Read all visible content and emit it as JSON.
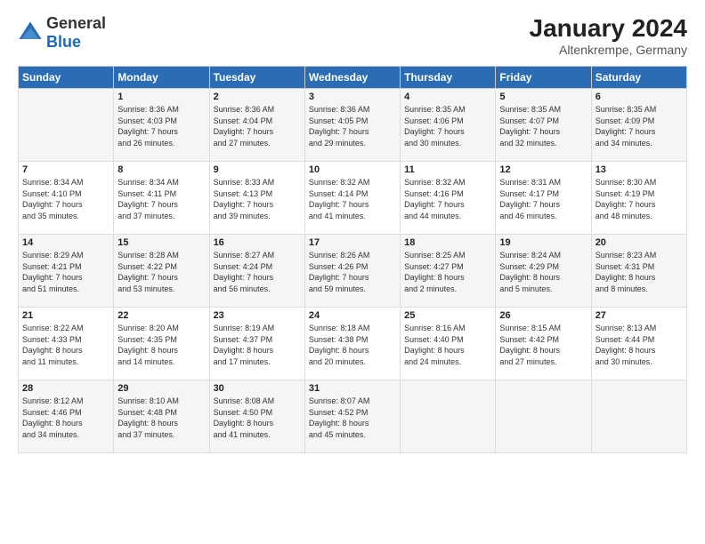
{
  "logo": {
    "general": "General",
    "blue": "Blue"
  },
  "header": {
    "month_year": "January 2024",
    "location": "Altenkrempe, Germany"
  },
  "days_of_week": [
    "Sunday",
    "Monday",
    "Tuesday",
    "Wednesday",
    "Thursday",
    "Friday",
    "Saturday"
  ],
  "weeks": [
    [
      {
        "day": "",
        "info": ""
      },
      {
        "day": "1",
        "info": "Sunrise: 8:36 AM\nSunset: 4:03 PM\nDaylight: 7 hours\nand 26 minutes."
      },
      {
        "day": "2",
        "info": "Sunrise: 8:36 AM\nSunset: 4:04 PM\nDaylight: 7 hours\nand 27 minutes."
      },
      {
        "day": "3",
        "info": "Sunrise: 8:36 AM\nSunset: 4:05 PM\nDaylight: 7 hours\nand 29 minutes."
      },
      {
        "day": "4",
        "info": "Sunrise: 8:35 AM\nSunset: 4:06 PM\nDaylight: 7 hours\nand 30 minutes."
      },
      {
        "day": "5",
        "info": "Sunrise: 8:35 AM\nSunset: 4:07 PM\nDaylight: 7 hours\nand 32 minutes."
      },
      {
        "day": "6",
        "info": "Sunrise: 8:35 AM\nSunset: 4:09 PM\nDaylight: 7 hours\nand 34 minutes."
      }
    ],
    [
      {
        "day": "7",
        "info": "Sunrise: 8:34 AM\nSunset: 4:10 PM\nDaylight: 7 hours\nand 35 minutes."
      },
      {
        "day": "8",
        "info": "Sunrise: 8:34 AM\nSunset: 4:11 PM\nDaylight: 7 hours\nand 37 minutes."
      },
      {
        "day": "9",
        "info": "Sunrise: 8:33 AM\nSunset: 4:13 PM\nDaylight: 7 hours\nand 39 minutes."
      },
      {
        "day": "10",
        "info": "Sunrise: 8:32 AM\nSunset: 4:14 PM\nDaylight: 7 hours\nand 41 minutes."
      },
      {
        "day": "11",
        "info": "Sunrise: 8:32 AM\nSunset: 4:16 PM\nDaylight: 7 hours\nand 44 minutes."
      },
      {
        "day": "12",
        "info": "Sunrise: 8:31 AM\nSunset: 4:17 PM\nDaylight: 7 hours\nand 46 minutes."
      },
      {
        "day": "13",
        "info": "Sunrise: 8:30 AM\nSunset: 4:19 PM\nDaylight: 7 hours\nand 48 minutes."
      }
    ],
    [
      {
        "day": "14",
        "info": "Sunrise: 8:29 AM\nSunset: 4:21 PM\nDaylight: 7 hours\nand 51 minutes."
      },
      {
        "day": "15",
        "info": "Sunrise: 8:28 AM\nSunset: 4:22 PM\nDaylight: 7 hours\nand 53 minutes."
      },
      {
        "day": "16",
        "info": "Sunrise: 8:27 AM\nSunset: 4:24 PM\nDaylight: 7 hours\nand 56 minutes."
      },
      {
        "day": "17",
        "info": "Sunrise: 8:26 AM\nSunset: 4:26 PM\nDaylight: 7 hours\nand 59 minutes."
      },
      {
        "day": "18",
        "info": "Sunrise: 8:25 AM\nSunset: 4:27 PM\nDaylight: 8 hours\nand 2 minutes."
      },
      {
        "day": "19",
        "info": "Sunrise: 8:24 AM\nSunset: 4:29 PM\nDaylight: 8 hours\nand 5 minutes."
      },
      {
        "day": "20",
        "info": "Sunrise: 8:23 AM\nSunset: 4:31 PM\nDaylight: 8 hours\nand 8 minutes."
      }
    ],
    [
      {
        "day": "21",
        "info": "Sunrise: 8:22 AM\nSunset: 4:33 PM\nDaylight: 8 hours\nand 11 minutes."
      },
      {
        "day": "22",
        "info": "Sunrise: 8:20 AM\nSunset: 4:35 PM\nDaylight: 8 hours\nand 14 minutes."
      },
      {
        "day": "23",
        "info": "Sunrise: 8:19 AM\nSunset: 4:37 PM\nDaylight: 8 hours\nand 17 minutes."
      },
      {
        "day": "24",
        "info": "Sunrise: 8:18 AM\nSunset: 4:38 PM\nDaylight: 8 hours\nand 20 minutes."
      },
      {
        "day": "25",
        "info": "Sunrise: 8:16 AM\nSunset: 4:40 PM\nDaylight: 8 hours\nand 24 minutes."
      },
      {
        "day": "26",
        "info": "Sunrise: 8:15 AM\nSunset: 4:42 PM\nDaylight: 8 hours\nand 27 minutes."
      },
      {
        "day": "27",
        "info": "Sunrise: 8:13 AM\nSunset: 4:44 PM\nDaylight: 8 hours\nand 30 minutes."
      }
    ],
    [
      {
        "day": "28",
        "info": "Sunrise: 8:12 AM\nSunset: 4:46 PM\nDaylight: 8 hours\nand 34 minutes."
      },
      {
        "day": "29",
        "info": "Sunrise: 8:10 AM\nSunset: 4:48 PM\nDaylight: 8 hours\nand 37 minutes."
      },
      {
        "day": "30",
        "info": "Sunrise: 8:08 AM\nSunset: 4:50 PM\nDaylight: 8 hours\nand 41 minutes."
      },
      {
        "day": "31",
        "info": "Sunrise: 8:07 AM\nSunset: 4:52 PM\nDaylight: 8 hours\nand 45 minutes."
      },
      {
        "day": "",
        "info": ""
      },
      {
        "day": "",
        "info": ""
      },
      {
        "day": "",
        "info": ""
      }
    ]
  ]
}
